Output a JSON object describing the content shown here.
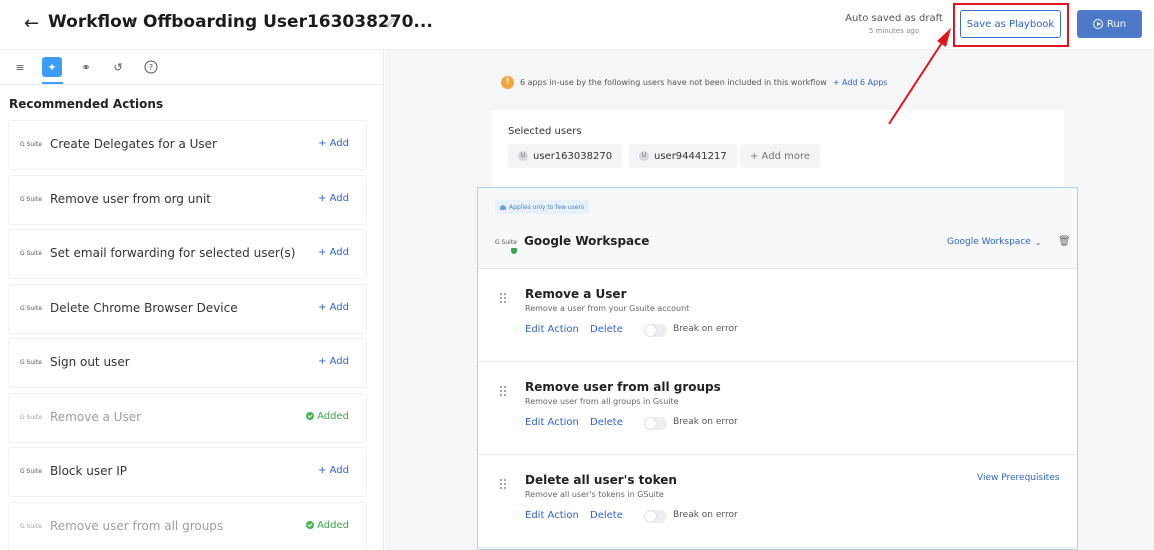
{
  "header": {
    "back_icon": "arrow-left-icon",
    "breadcrumb_root": "Workflow",
    "breadcrumb_sep": "›",
    "title": "Offboarding User163038270...",
    "autosave_status": "Auto saved as draft",
    "autosave_time": "5 minutes ago",
    "save_playbook_label": "Save as Playbook",
    "run_label": "Run"
  },
  "sidebar": {
    "toolbar": [
      {
        "icon": "list-icon",
        "glyph": "≡"
      },
      {
        "icon": "sparkle-icon",
        "glyph": "✦"
      },
      {
        "icon": "link-icon",
        "glyph": "⚭"
      },
      {
        "icon": "history-icon",
        "glyph": "↺"
      },
      {
        "icon": "help-icon",
        "glyph": "?"
      }
    ],
    "section_title": "Recommended Actions",
    "items": [
      {
        "app": "G Suite",
        "label": "Create Delegates for a User",
        "action": "+ Add",
        "added": false
      },
      {
        "app": "G Suite",
        "label": "Remove user from org unit",
        "action": "+ Add",
        "added": false
      },
      {
        "app": "G Suite",
        "label": "Set email forwarding for selected user(s)",
        "action": "+ Add",
        "added": false
      },
      {
        "app": "G Suite",
        "label": "Delete Chrome Browser Device",
        "action": "+ Add",
        "added": false
      },
      {
        "app": "G Suite",
        "label": "Sign out user",
        "action": "+ Add",
        "added": false
      },
      {
        "app": "G Suite",
        "label": "Remove a User",
        "action": "Added",
        "added": true
      },
      {
        "app": "G Suite",
        "label": "Block user IP",
        "action": "+ Add",
        "added": false
      },
      {
        "app": "G Suite",
        "label": "Remove user from all groups",
        "action": "Added",
        "added": true
      }
    ]
  },
  "notice": {
    "icon": "warning-icon",
    "text": "6 apps in-use by the following users have not been included in this workflow",
    "link": "+ Add 6 Apps"
  },
  "selected_users": {
    "title": "Selected users",
    "users": [
      "user163038270",
      "user94441217"
    ],
    "add_more": "+ Add more"
  },
  "workflow_card": {
    "applies_badge": "Applies only to few users",
    "app_logo": "G Suite",
    "app_title": "Google Workspace",
    "app_select": "Google Workspace",
    "actions": [
      {
        "title": "Remove a User",
        "desc": "Remove a user from your Gsuite account",
        "edit": "Edit Action",
        "delete": "Delete",
        "break_label": "Break on error",
        "prereq": ""
      },
      {
        "title": "Remove user from all groups",
        "desc": "Remove user from all groups in Gsuite",
        "edit": "Edit Action",
        "delete": "Delete",
        "break_label": "Break on error",
        "prereq": ""
      },
      {
        "title": "Delete all user's token",
        "desc": "Remove all user's tokens in GSuite",
        "edit": "Edit Action",
        "delete": "Delete",
        "break_label": "Break on error",
        "prereq": "View Prerequisites"
      }
    ]
  },
  "colors": {
    "accent": "#2f63c9",
    "run_button": "#4e79c8",
    "highlight_box": "#e0161c",
    "added_green": "#3aa64a",
    "warning": "#f5a540"
  }
}
